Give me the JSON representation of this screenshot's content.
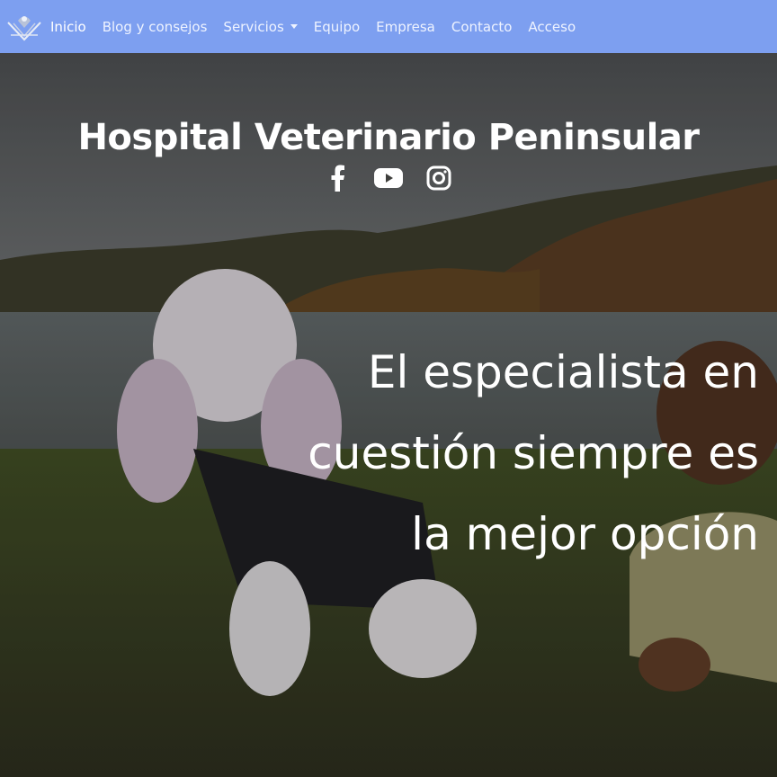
{
  "navbar": {
    "logo_icon": "veterinary-logo-icon",
    "items": [
      {
        "label": "Inicio",
        "active": true
      },
      {
        "label": "Blog y consejos"
      },
      {
        "label": "Servicios",
        "dropdown": true
      },
      {
        "label": "Equipo"
      },
      {
        "label": "Empresa"
      },
      {
        "label": "Contacto"
      },
      {
        "label": "Acceso"
      }
    ],
    "background": "#7d9ff0"
  },
  "hero": {
    "title": "Hospital Veterinario Peninsular",
    "social": [
      {
        "icon": "facebook-icon"
      },
      {
        "icon": "youtube-icon"
      },
      {
        "icon": "instagram-icon"
      }
    ],
    "tagline_lines": [
      "El especialista en",
      "cuestión siempre es",
      "la mejor opción"
    ]
  }
}
